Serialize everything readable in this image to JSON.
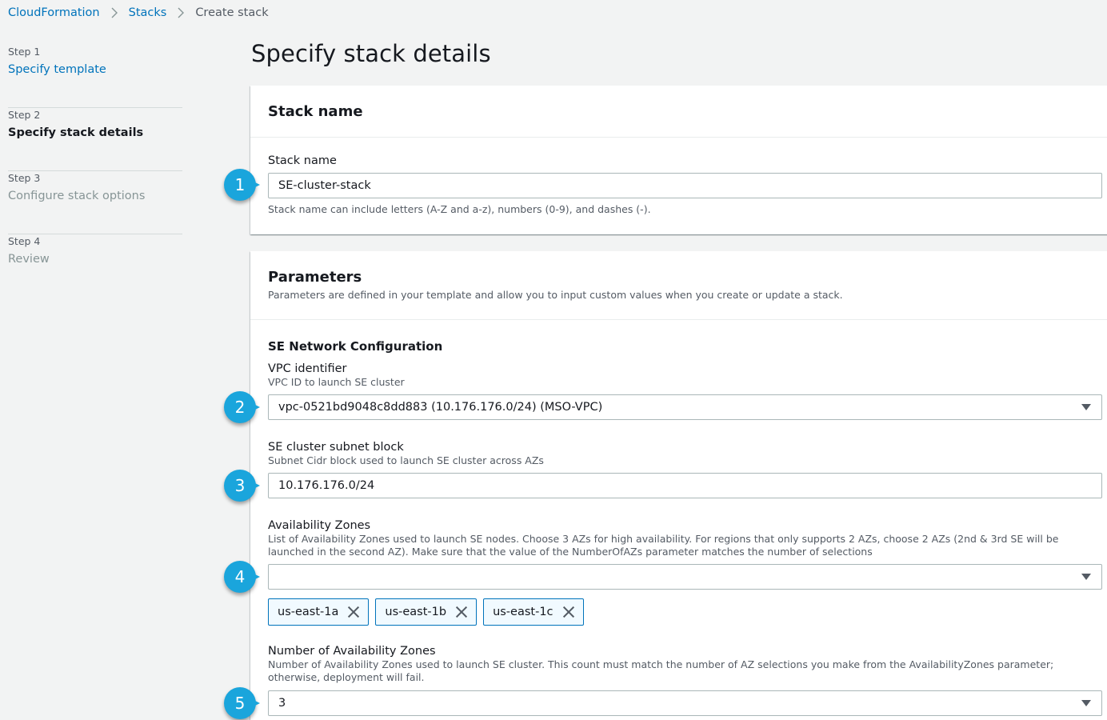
{
  "breadcrumb": {
    "root": "CloudFormation",
    "stacks": "Stacks",
    "current": "Create stack"
  },
  "steps": [
    {
      "label": "Step 1",
      "name": "Specify template"
    },
    {
      "label": "Step 2",
      "name": "Specify stack details"
    },
    {
      "label": "Step 3",
      "name": "Configure stack options"
    },
    {
      "label": "Step 4",
      "name": "Review"
    }
  ],
  "page_title": "Specify stack details",
  "stack_panel": {
    "title": "Stack name",
    "field_label": "Stack name",
    "value": "SE-cluster-stack",
    "help": "Stack name can include letters (A-Z and a-z), numbers (0-9), and dashes (-)."
  },
  "params_panel": {
    "title": "Parameters",
    "desc": "Parameters are defined in your template and allow you to input custom values when you create or update a stack.",
    "section": "SE Network Configuration",
    "vpc": {
      "label": "VPC identifier",
      "sub": "VPC ID to launch SE cluster",
      "value": "vpc-0521bd9048c8dd883 (10.176.176.0/24) (MSO-VPC)"
    },
    "subnet": {
      "label": "SE cluster subnet block",
      "sub": "Subnet Cidr block used to launch SE cluster across AZs",
      "value": "10.176.176.0/24"
    },
    "azs": {
      "label": "Availability Zones",
      "sub": "List of Availability Zones used to launch SE nodes. Choose 3 AZs for high availability. For regions that only supports 2 AZs, choose 2 AZs (2nd & 3rd SE will be launched in the second AZ). Make sure that the value of the NumberOfAZs parameter matches the number of selections",
      "value": "",
      "tokens": [
        "us-east-1a",
        "us-east-1b",
        "us-east-1c"
      ]
    },
    "num_azs": {
      "label": "Number of Availability Zones",
      "sub": "Number of Availability Zones used to launch SE cluster. This count must match the number of AZ selections you make from the AvailabilityZones parameter; otherwise, deployment will fail.",
      "value": "3"
    }
  },
  "callouts": [
    "1",
    "2",
    "3",
    "4",
    "5"
  ],
  "colors": {
    "link": "#0073bb",
    "callout": "#1aa5dc",
    "token_border": "#0073bb",
    "token_bg": "#f1faff"
  }
}
